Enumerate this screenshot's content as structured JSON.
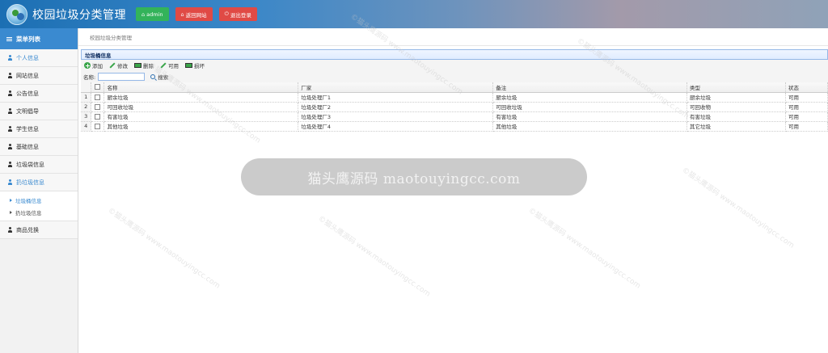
{
  "header": {
    "title": "校园垃圾分类管理",
    "buttons": [
      {
        "icon": "home-icon",
        "label": "admin"
      },
      {
        "icon": "home-icon",
        "label": "返回网站"
      },
      {
        "icon": "power-icon",
        "label": "退出登录"
      }
    ]
  },
  "sidebar": {
    "heading": "菜单列表",
    "items": [
      {
        "label": "个人信息",
        "active": true
      },
      {
        "label": "网站信息"
      },
      {
        "label": "公告信息"
      },
      {
        "label": "文明倡导"
      },
      {
        "label": "学生信息"
      },
      {
        "label": "基础信息"
      },
      {
        "label": "垃圾袋信息"
      },
      {
        "label": "扔垃圾信息",
        "open": true
      },
      {
        "label": "商品兑换"
      }
    ],
    "subitems": [
      {
        "label": "垃圾桶信息",
        "active": true
      },
      {
        "label": "扔垃圾信息"
      }
    ]
  },
  "breadcrumb": "校园垃圾分类管理",
  "panel": {
    "title": "垃圾桶信息",
    "toolbar": {
      "add": "添加",
      "edit": "修改",
      "delete": "删除",
      "enable": "可用",
      "broken": "损坏"
    },
    "search": {
      "label": "名称:",
      "value": "",
      "button": "搜索"
    }
  },
  "table": {
    "headers": [
      "名称",
      "厂家",
      "备注",
      "类型",
      "状态"
    ],
    "rows": [
      {
        "n": "1",
        "name": "厨余垃圾",
        "factory": "垃圾处理厂1",
        "note": "厨余垃圾",
        "type": "厨余垃圾",
        "status": "可用"
      },
      {
        "n": "2",
        "name": "可回收垃圾",
        "factory": "垃圾处理厂2",
        "note": "可回收垃圾",
        "type": "可回收物",
        "status": "可用"
      },
      {
        "n": "3",
        "name": "有害垃圾",
        "factory": "垃圾处理厂3",
        "note": "有害垃圾",
        "type": "有害垃圾",
        "status": "可用"
      },
      {
        "n": "4",
        "name": "其他垃圾",
        "factory": "垃圾处理厂4",
        "note": "其他垃圾",
        "type": "其它垃圾",
        "status": "可用"
      }
    ]
  },
  "watermark": {
    "banner": "猫头鹰源码 maotouyingcc.com",
    "text": "©猫头鹰源码 www.maotouyingcc.com"
  },
  "colors": {
    "accent": "#3a8ad0",
    "green": "#33b35a",
    "red": "#e04a45"
  }
}
